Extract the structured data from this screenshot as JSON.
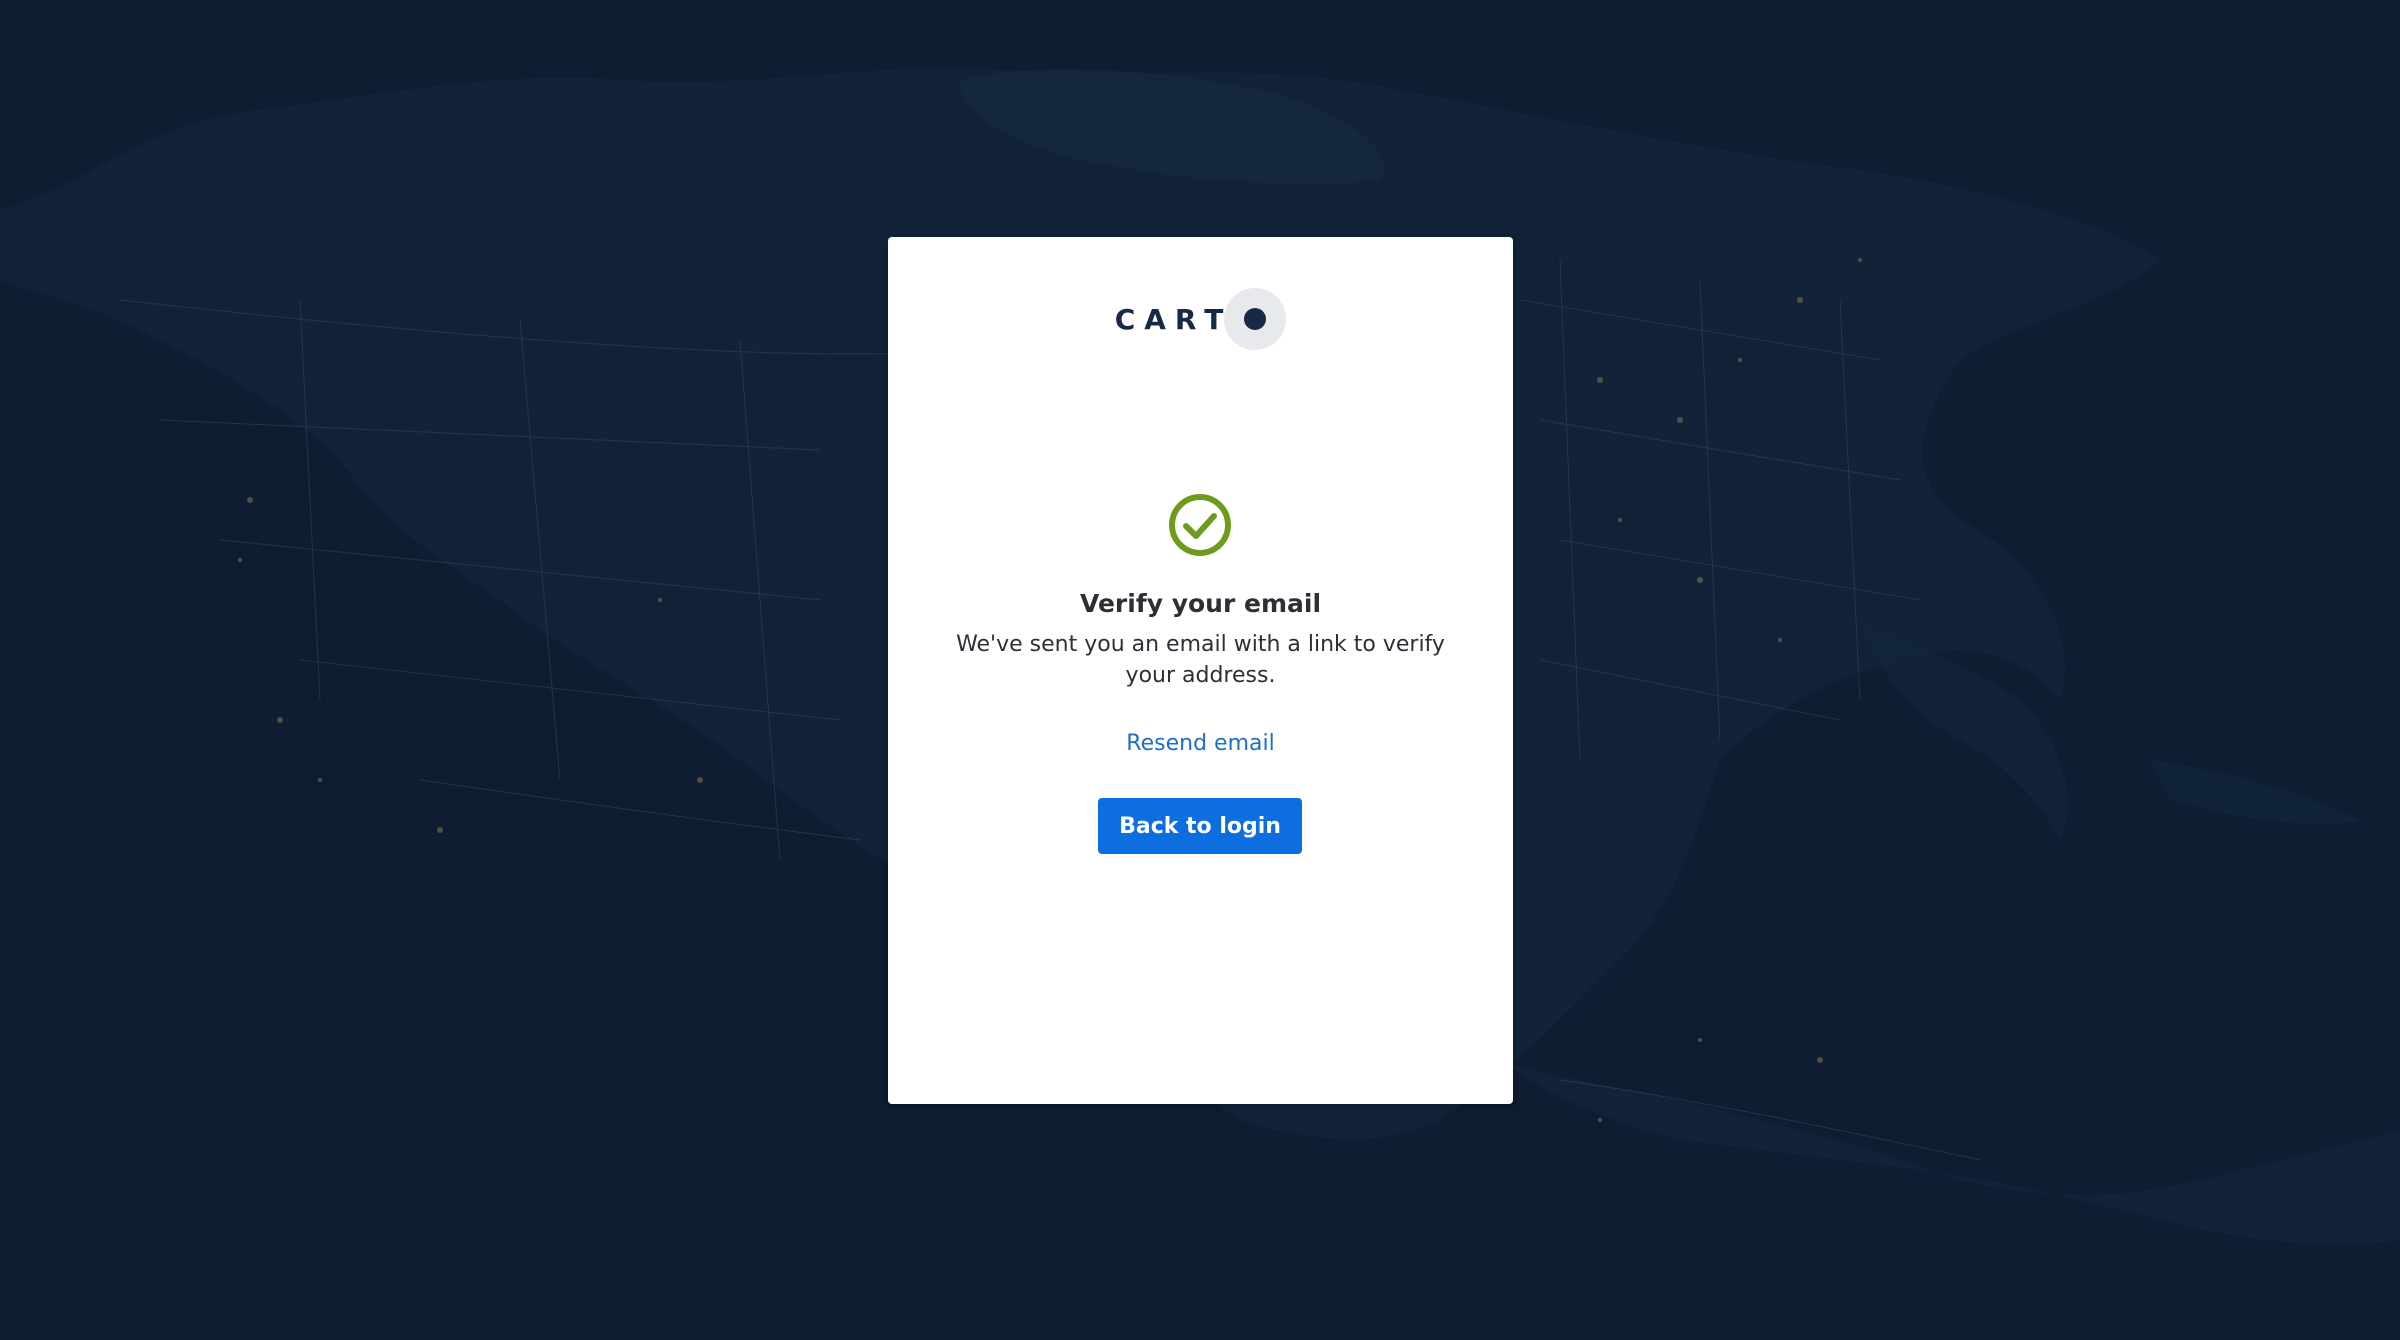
{
  "background": {
    "theme": "dark-map",
    "base_color": "#0e1d31",
    "land_color": "#13253b",
    "line_color": "#3a4a55",
    "city_light_color": "#8a7a55"
  },
  "card": {
    "logo": {
      "text": "CARTO",
      "letters": "CART",
      "color": "#162945",
      "halo_color": "#e8e9ed"
    },
    "status_icon": "check-circle-icon",
    "status_color": "#6e9a1d",
    "title": "Verify your email",
    "description": "We've sent you an email with a link to verify your address.",
    "resend_label": "Resend email",
    "back_button_label": "Back to login",
    "accent_color": "#0d6ee0",
    "link_color": "#1f6fc9"
  }
}
